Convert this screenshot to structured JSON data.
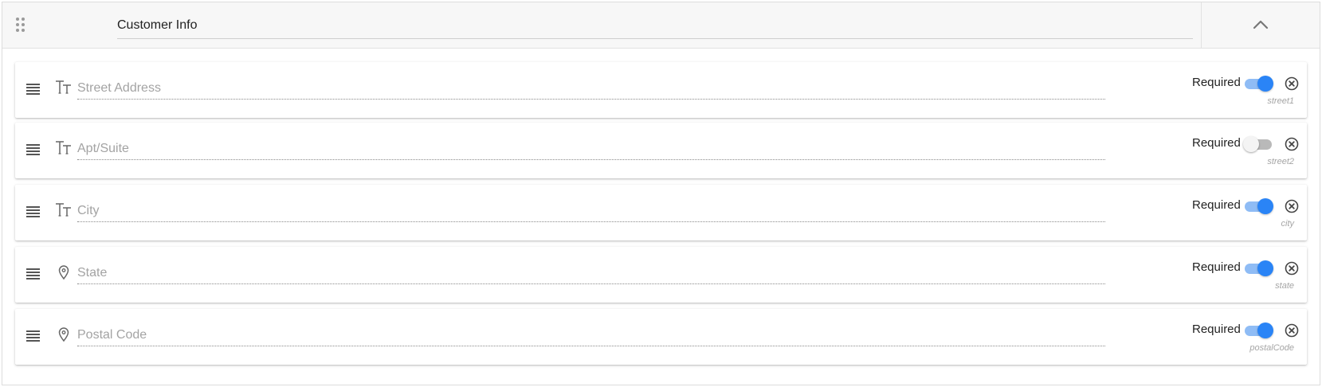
{
  "section": {
    "title": "Customer Info",
    "drag_icon": "drag-dots-icon",
    "collapse_icon": "chevron-up-icon"
  },
  "colors": {
    "toggle_on": "#2a84f6",
    "toggle_on_track": "#8fbcf5",
    "toggle_off_track": "#b9b9b9"
  },
  "fields": [
    {
      "placeholder": "Street Address",
      "type_icon": "text-type-icon",
      "required_label": "Required",
      "required": true,
      "key": "street1"
    },
    {
      "placeholder": "Apt/Suite",
      "type_icon": "text-type-icon",
      "required_label": "Required",
      "required": false,
      "key": "street2"
    },
    {
      "placeholder": "City",
      "type_icon": "text-type-icon",
      "required_label": "Required",
      "required": true,
      "key": "city"
    },
    {
      "placeholder": "State",
      "type_icon": "location-pin-icon",
      "required_label": "Required",
      "required": true,
      "key": "state"
    },
    {
      "placeholder": "Postal Code",
      "type_icon": "location-pin-icon",
      "required_label": "Required",
      "required": true,
      "key": "postalCode"
    }
  ]
}
